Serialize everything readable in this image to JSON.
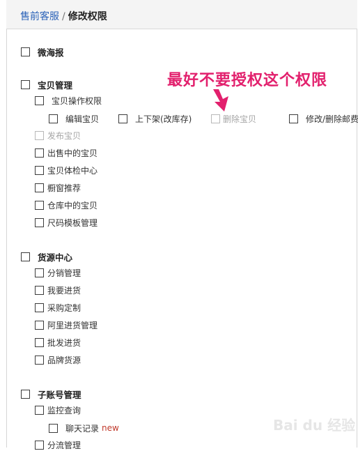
{
  "breadcrumb": {
    "link": "售前客服",
    "separator": "/",
    "current": "修改权限"
  },
  "annotation": "最好不要授权这个权限",
  "watermark": "Bai du 经验",
  "sections": {
    "weihaibao": "微海报",
    "baobei": {
      "label": "宝贝管理",
      "op": "宝贝操作权限",
      "op_children": [
        "编辑宝贝",
        "上下架(改库存)",
        "删除宝贝",
        "修改/删除邮费"
      ],
      "children": [
        "发布宝贝",
        "出售中的宝贝",
        "宝贝体检中心",
        "橱窗推荐",
        "仓库中的宝贝",
        "尺码模板管理"
      ]
    },
    "huoyuan": {
      "label": "货源中心",
      "children": [
        "分销管理",
        "我要进货",
        "采购定制",
        "阿里进货管理",
        "批发进货",
        "品牌货源"
      ]
    },
    "zizhanghao": {
      "label": "子账号管理",
      "jiankong": "监控查询",
      "chat": "聊天记录",
      "new_badge": "new",
      "fenliu": "分流管理"
    }
  }
}
